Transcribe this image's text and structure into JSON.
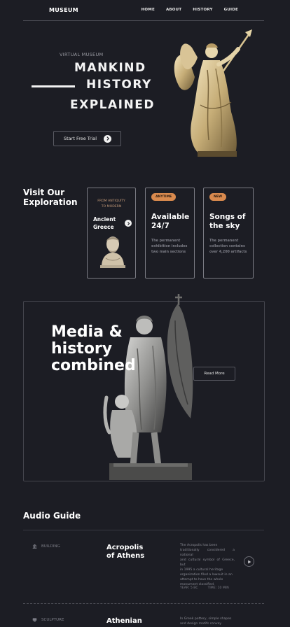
{
  "nav": {
    "logo": "MUSEUM",
    "links": [
      "HOME",
      "ABOUT",
      "HISTORY",
      "GUIDE"
    ]
  },
  "hero": {
    "kicker": "VIRTUAL MUSEUM",
    "title_lines": [
      "MANKIND",
      "HISTORY",
      "EXPLAINED"
    ],
    "cta": "Start Free Trial"
  },
  "explore": {
    "title_lines": [
      "Visit Our",
      "Exploration"
    ],
    "cards": [
      {
        "subtitle_lines": [
          "FROM ANTIQUITY",
          "TO MODERN"
        ],
        "title_lines": [
          "Ancient",
          "Greece"
        ]
      },
      {
        "badge": "ANYTIME",
        "title_lines": [
          "Available",
          "24/7"
        ],
        "desc_lines": [
          "The permanent",
          "exhibition includes",
          "two main sections"
        ]
      },
      {
        "badge": "NEW",
        "title_lines": [
          "Songs of",
          "the sky"
        ],
        "desc_lines": [
          "The permanent",
          "collection contains",
          "over 4,200 artifacts"
        ]
      }
    ]
  },
  "media": {
    "title_lines": [
      "Media &",
      "history",
      "combined"
    ],
    "button": "Read More"
  },
  "audio_guide": {
    "title": "Audio Guide",
    "rows": [
      {
        "category": "BUILDING",
        "name_lines": [
          "Acropolis",
          "of Athens"
        ],
        "desc_lines": [
          "The Acropolis has been",
          "traditionally considered a national",
          "and cultural symbol of Greece, but",
          "in 1995 a cultural heritage",
          "organization filed a lawsuit in an",
          "attempt to have the whole",
          "monument classified."
        ],
        "year": "YEAR: 5 BC",
        "time": "TIME: 10 MIN"
      },
      {
        "category": "SCULPTURE",
        "name_lines": [
          "Athenian"
        ],
        "desc_lines": [
          "In Greek pottery, simple shapes",
          "and design motifs convey"
        ]
      }
    ]
  },
  "colors": {
    "background": "#1c1d24",
    "accent_badge": "#d98a4e",
    "card_subtitle": "#c49a79"
  },
  "icons": [
    "arrow-right-icon",
    "building-icon",
    "sculpture-icon",
    "play-icon"
  ]
}
